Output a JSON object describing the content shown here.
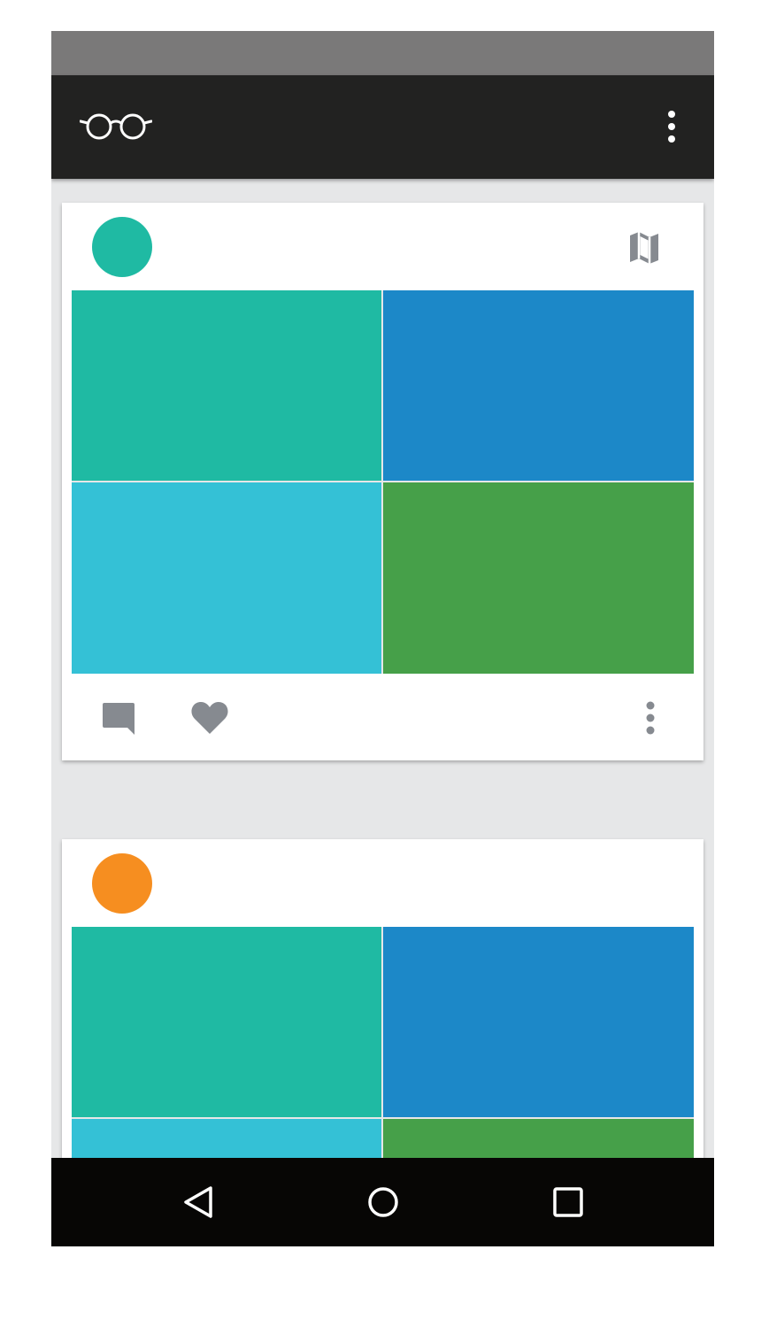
{
  "colors": {
    "status_bar": "#7a7979",
    "app_bar": "#222221",
    "background": "#e6e7e8",
    "card": "#ffffff",
    "icon_gray": "#868a90",
    "nav_bar": "#070605"
  },
  "app_bar": {
    "logo_icon": "glasses-icon",
    "menu_icon": "more-vert-icon"
  },
  "posts": [
    {
      "avatar_color": "#1fbaa3",
      "header_icon": "map-icon",
      "tiles": [
        "#1fbaa3",
        "#1c88c8",
        "#34c1d6",
        "#46a049"
      ],
      "actions": [
        "comment-icon",
        "heart-icon",
        "more-vert-icon"
      ]
    },
    {
      "avatar_color": "#f68e20",
      "tiles": [
        "#1fbaa3",
        "#1c88c8",
        "#34c1d6",
        "#46a049"
      ]
    }
  ],
  "nav_bar": {
    "icons": [
      "back-icon",
      "home-icon",
      "recents-icon"
    ]
  }
}
